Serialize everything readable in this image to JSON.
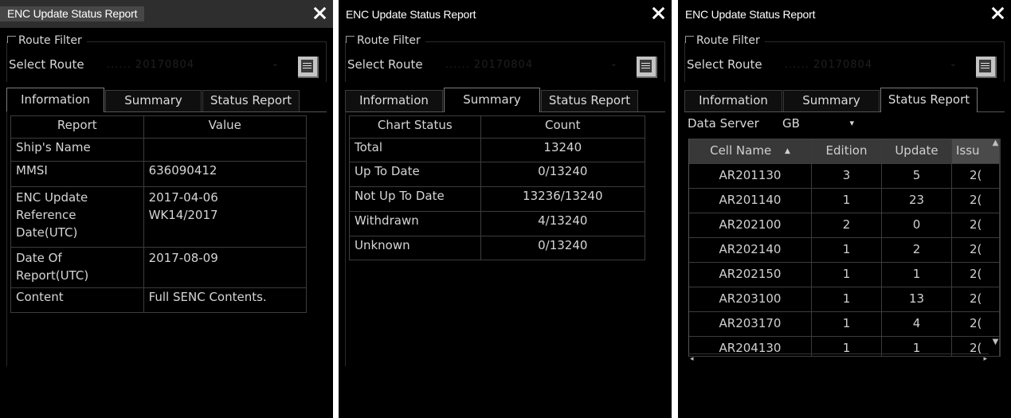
{
  "window_title": "ENC Update Status Report",
  "route_filter_label": "Route Filter",
  "select_route_label": "Select Route",
  "select_route_value": "...... 20170804",
  "tabs": [
    "Information",
    "Summary",
    "Status Report"
  ],
  "information": {
    "columns": [
      "Report",
      "Value"
    ],
    "rows": [
      {
        "report": "Ship's Name",
        "value": ""
      },
      {
        "report": "MMSI",
        "value": "636090412"
      },
      {
        "report": "ENC Update\nReference\nDate(UTC)",
        "value": "2017-04-06\nWK14/2017"
      },
      {
        "report": "Date Of\nReport(UTC)",
        "value": "2017-08-09"
      },
      {
        "report": "Content",
        "value": "Full SENC Contents."
      }
    ]
  },
  "summary": {
    "columns": [
      "Chart Status",
      "Count"
    ],
    "rows": [
      {
        "status": "Total",
        "count": "13240"
      },
      {
        "status": "Up To Date",
        "count": "0/13240"
      },
      {
        "status": "Not Up To Date",
        "count": "13236/13240"
      },
      {
        "status": "Withdrawn",
        "count": "4/13240"
      },
      {
        "status": "Unknown",
        "count": "0/13240"
      }
    ]
  },
  "status_report": {
    "data_server_label": "Data Server",
    "data_server_value": "GB",
    "columns": [
      "Cell Name",
      "Edition",
      "Update",
      "Issu"
    ],
    "sort_indicator": "▲",
    "rows": [
      {
        "cell": "AR201130",
        "edition": "3",
        "update": "5",
        "issue": "2("
      },
      {
        "cell": "AR201140",
        "edition": "1",
        "update": "23",
        "issue": "2("
      },
      {
        "cell": "AR202100",
        "edition": "2",
        "update": "0",
        "issue": "2("
      },
      {
        "cell": "AR202140",
        "edition": "1",
        "update": "2",
        "issue": "2("
      },
      {
        "cell": "AR202150",
        "edition": "1",
        "update": "1",
        "issue": "2("
      },
      {
        "cell": "AR203100",
        "edition": "1",
        "update": "13",
        "issue": "2("
      },
      {
        "cell": "AR203170",
        "edition": "1",
        "update": "4",
        "issue": "2("
      },
      {
        "cell": "AR204130",
        "edition": "1",
        "update": "1",
        "issue": "2("
      }
    ]
  },
  "icons": {
    "close": "close-icon",
    "list": "list-icon",
    "dropdown": "chevron-down-icon"
  },
  "colors": {
    "background": "#000000",
    "text": "#d8d8d8",
    "title_highlight": "#474747"
  }
}
